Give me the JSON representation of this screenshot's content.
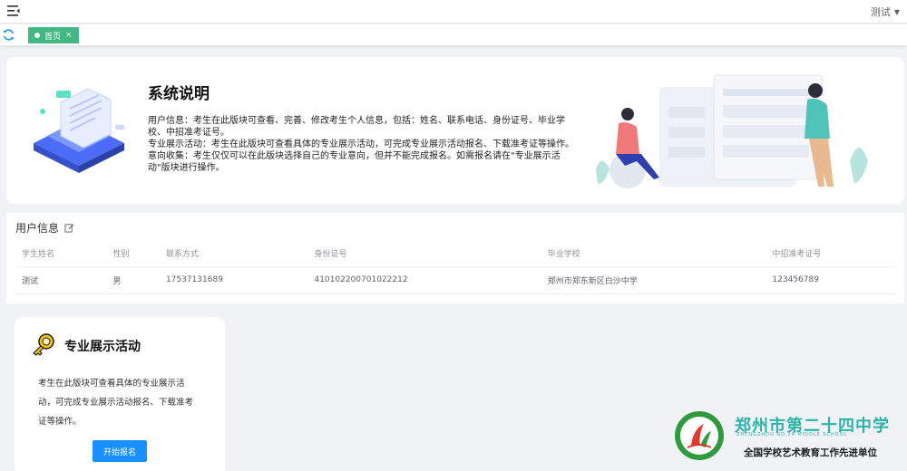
{
  "header": {
    "menu_icon": "menu-fold-icon",
    "user_name": "测试"
  },
  "tabs": {
    "refresh_icon": "refresh-icon",
    "items": [
      {
        "label": "首页",
        "close": "×"
      }
    ]
  },
  "intro": {
    "title": "系统说明",
    "paragraphs": [
      "用户信息：考生在此版块可查看、完善、修改考生个人信息，包括：姓名、联系电话、身份证号、毕业学校、中招准考证号。",
      "专业展示活动：考生在此版块可查看具体的专业展示活动，可完成专业展示活动报名、下载准考证等操作。",
      "意向收集：考生仅仅可以在此版块选择自己的专业意向，但并不能完成报名。如需报名请在\"专业展示活动\"版块进行操作。"
    ]
  },
  "user_info": {
    "title": "用户信息",
    "edit_icon": "edit-icon",
    "columns": [
      "学生姓名",
      "性别",
      "联系方式",
      "身份证号",
      "毕业学校",
      "中招准考证号"
    ],
    "row": [
      "测试",
      "男",
      "17537131689",
      "410102200701022212",
      "郑州市郑东新区白沙中学",
      "123456789"
    ]
  },
  "activity_card": {
    "icon": "key-icon",
    "title": "专业展示活动",
    "description": "考生在此版块可查看具体的专业展示活动，可完成专业展示活动报名、下载准考证等操作。",
    "button_label": "开始报名"
  },
  "school": {
    "name": "郑州市第二十四中学",
    "sub": "ZHENGZHOU NO.24 MIDDLE SCHOOL",
    "slogan": "全国学校艺术教育工作先进单位"
  },
  "colors": {
    "tab_active": "#42b983",
    "primary": "#1890ff",
    "school_teal": "#2fb3a8",
    "background": "#f0f2f5"
  }
}
